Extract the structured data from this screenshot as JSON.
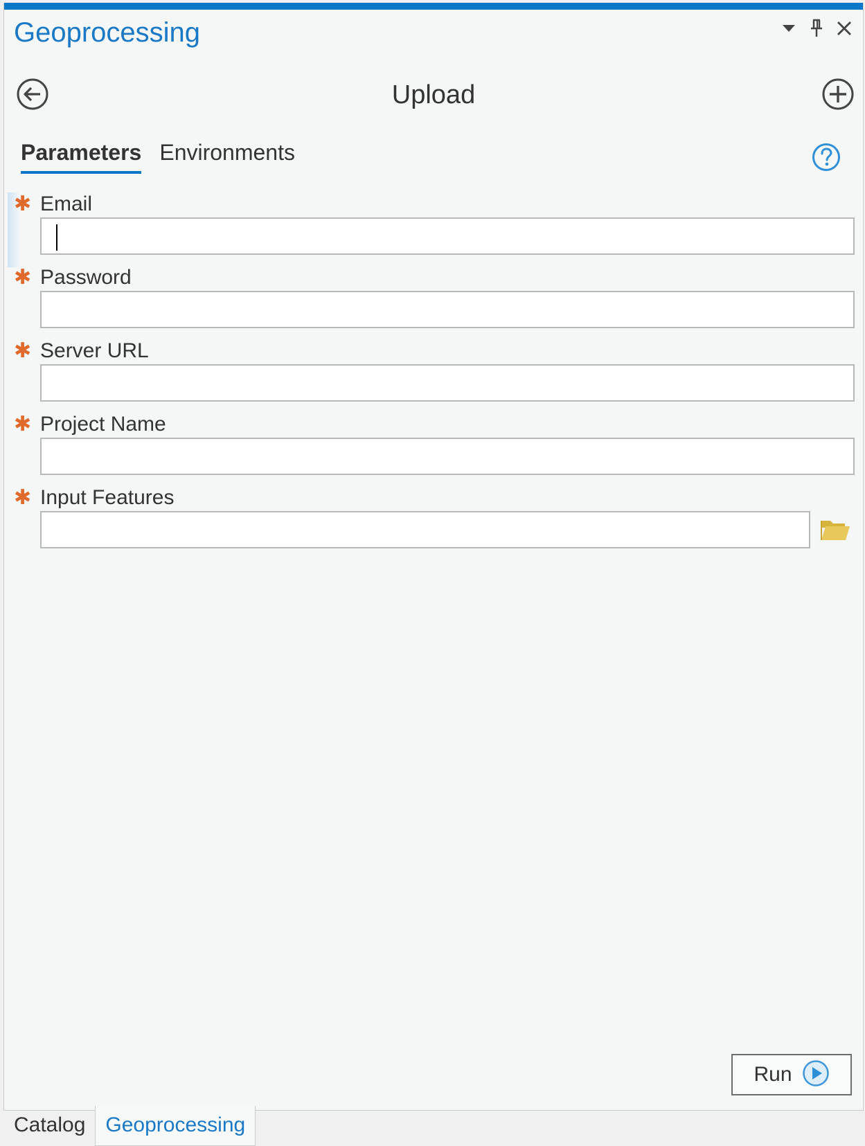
{
  "pane": {
    "title": "Geoprocessing",
    "controls": {
      "menu_icon": "chevron-down-icon",
      "pin_icon": "pin-icon",
      "close_icon": "close-icon"
    }
  },
  "tool": {
    "title": "Upload",
    "back_icon": "back-arrow-icon",
    "add_icon": "add-icon"
  },
  "tabs": [
    {
      "label": "Parameters",
      "active": true
    },
    {
      "label": "Environments",
      "active": false
    }
  ],
  "help_icon": "help-icon",
  "parameters": [
    {
      "label": "Email",
      "required": true,
      "value": ""
    },
    {
      "label": "Password",
      "required": true,
      "value": ""
    },
    {
      "label": "Server URL",
      "required": true,
      "value": ""
    },
    {
      "label": "Project Name",
      "required": true,
      "value": ""
    },
    {
      "label": "Input Features",
      "required": true,
      "value": "",
      "browse_icon": "folder-icon"
    }
  ],
  "required_marker": "✱",
  "run": {
    "label": "Run",
    "icon": "play-icon"
  },
  "bottom_tabs": [
    {
      "label": "Catalog",
      "active": false
    },
    {
      "label": "Geoprocessing",
      "active": true
    }
  ],
  "colors": {
    "accent": "#0b77c8",
    "title_blue": "#1a79c6",
    "required": "#e06a2c",
    "folder": "#e2c14a"
  }
}
